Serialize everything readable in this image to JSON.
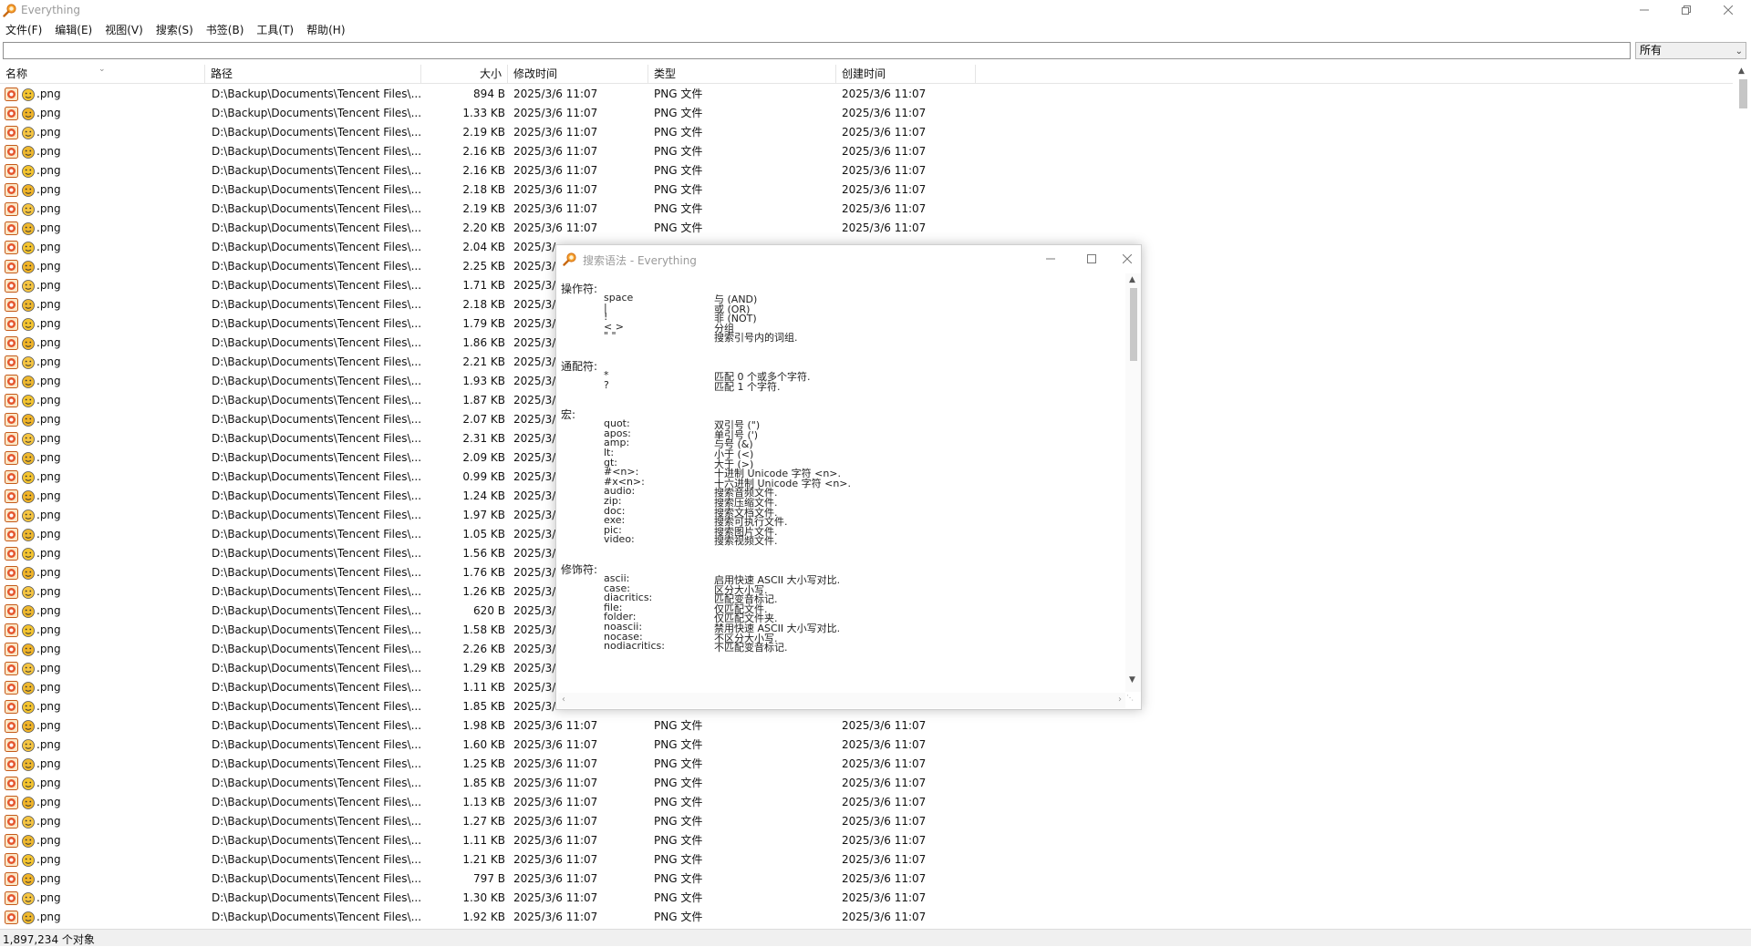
{
  "window": {
    "title": "Everything"
  },
  "menu": [
    "文件(F)",
    "编辑(E)",
    "视图(V)",
    "搜索(S)",
    "书签(B)",
    "工具(T)",
    "帮助(H)"
  ],
  "search": {
    "value": "",
    "placeholder": ""
  },
  "filter": {
    "selected": "所有"
  },
  "columns": {
    "name": "名称",
    "path": "路径",
    "size": "大小",
    "modified": "修改时间",
    "type": "类型",
    "created": "创建时间"
  },
  "rows": [
    {
      "name": ".png",
      "path": "D:\\Backup\\Documents\\Tencent Files\\...",
      "size": "894 B",
      "modified": "2025/3/6 11:07",
      "type": "PNG 文件",
      "created": "2025/3/6 11:07"
    },
    {
      "name": ".png",
      "path": "D:\\Backup\\Documents\\Tencent Files\\...",
      "size": "1.33 KB",
      "modified": "2025/3/6 11:07",
      "type": "PNG 文件",
      "created": "2025/3/6 11:07"
    },
    {
      "name": ".png",
      "path": "D:\\Backup\\Documents\\Tencent Files\\...",
      "size": "2.19 KB",
      "modified": "2025/3/6 11:07",
      "type": "PNG 文件",
      "created": "2025/3/6 11:07"
    },
    {
      "name": ".png",
      "path": "D:\\Backup\\Documents\\Tencent Files\\...",
      "size": "2.16 KB",
      "modified": "2025/3/6 11:07",
      "type": "PNG 文件",
      "created": "2025/3/6 11:07"
    },
    {
      "name": ".png",
      "path": "D:\\Backup\\Documents\\Tencent Files\\...",
      "size": "2.16 KB",
      "modified": "2025/3/6 11:07",
      "type": "PNG 文件",
      "created": "2025/3/6 11:07"
    },
    {
      "name": ".png",
      "path": "D:\\Backup\\Documents\\Tencent Files\\...",
      "size": "2.18 KB",
      "modified": "2025/3/6 11:07",
      "type": "PNG 文件",
      "created": "2025/3/6 11:07"
    },
    {
      "name": ".png",
      "path": "D:\\Backup\\Documents\\Tencent Files\\...",
      "size": "2.19 KB",
      "modified": "2025/3/6 11:07",
      "type": "PNG 文件",
      "created": "2025/3/6 11:07"
    },
    {
      "name": ".png",
      "path": "D:\\Backup\\Documents\\Tencent Files\\...",
      "size": "2.20 KB",
      "modified": "2025/3/6 11:07",
      "type": "PNG 文件",
      "created": "2025/3/6 11:07"
    },
    {
      "name": ".png",
      "path": "D:\\Backup\\Documents\\Tencent Files\\...",
      "size": "2.04 KB",
      "modified": "2025/3/",
      "type": "",
      "created": ""
    },
    {
      "name": ".png",
      "path": "D:\\Backup\\Documents\\Tencent Files\\...",
      "size": "2.25 KB",
      "modified": "2025/3/",
      "type": "",
      "created": ""
    },
    {
      "name": ".png",
      "path": "D:\\Backup\\Documents\\Tencent Files\\...",
      "size": "1.71 KB",
      "modified": "2025/3/",
      "type": "",
      "created": ""
    },
    {
      "name": ".png",
      "path": "D:\\Backup\\Documents\\Tencent Files\\...",
      "size": "2.18 KB",
      "modified": "2025/3/",
      "type": "",
      "created": ""
    },
    {
      "name": ".png",
      "path": "D:\\Backup\\Documents\\Tencent Files\\...",
      "size": "1.79 KB",
      "modified": "2025/3/",
      "type": "",
      "created": ""
    },
    {
      "name": ".png",
      "path": "D:\\Backup\\Documents\\Tencent Files\\...",
      "size": "1.86 KB",
      "modified": "2025/3/",
      "type": "",
      "created": ""
    },
    {
      "name": ".png",
      "path": "D:\\Backup\\Documents\\Tencent Files\\...",
      "size": "2.21 KB",
      "modified": "2025/3/",
      "type": "",
      "created": ""
    },
    {
      "name": ".png",
      "path": "D:\\Backup\\Documents\\Tencent Files\\...",
      "size": "1.93 KB",
      "modified": "2025/3/",
      "type": "",
      "created": ""
    },
    {
      "name": ".png",
      "path": "D:\\Backup\\Documents\\Tencent Files\\...",
      "size": "1.87 KB",
      "modified": "2025/3/",
      "type": "",
      "created": ""
    },
    {
      "name": ".png",
      "path": "D:\\Backup\\Documents\\Tencent Files\\...",
      "size": "2.07 KB",
      "modified": "2025/3/",
      "type": "",
      "created": ""
    },
    {
      "name": ".png",
      "path": "D:\\Backup\\Documents\\Tencent Files\\...",
      "size": "2.31 KB",
      "modified": "2025/3/",
      "type": "",
      "created": ""
    },
    {
      "name": ".png",
      "path": "D:\\Backup\\Documents\\Tencent Files\\...",
      "size": "2.09 KB",
      "modified": "2025/3/",
      "type": "",
      "created": ""
    },
    {
      "name": ".png",
      "path": "D:\\Backup\\Documents\\Tencent Files\\...",
      "size": "0.99 KB",
      "modified": "2025/3/",
      "type": "",
      "created": ""
    },
    {
      "name": ".png",
      "path": "D:\\Backup\\Documents\\Tencent Files\\...",
      "size": "1.24 KB",
      "modified": "2025/3/",
      "type": "",
      "created": ""
    },
    {
      "name": ".png",
      "path": "D:\\Backup\\Documents\\Tencent Files\\...",
      "size": "1.97 KB",
      "modified": "2025/3/",
      "type": "",
      "created": ""
    },
    {
      "name": ".png",
      "path": "D:\\Backup\\Documents\\Tencent Files\\...",
      "size": "1.05 KB",
      "modified": "2025/3/",
      "type": "",
      "created": ""
    },
    {
      "name": ".png",
      "path": "D:\\Backup\\Documents\\Tencent Files\\...",
      "size": "1.56 KB",
      "modified": "2025/3/",
      "type": "",
      "created": ""
    },
    {
      "name": ".png",
      "path": "D:\\Backup\\Documents\\Tencent Files\\...",
      "size": "1.76 KB",
      "modified": "2025/3/",
      "type": "",
      "created": ""
    },
    {
      "name": ".png",
      "path": "D:\\Backup\\Documents\\Tencent Files\\...",
      "size": "1.26 KB",
      "modified": "2025/3/",
      "type": "",
      "created": ""
    },
    {
      "name": ".png",
      "path": "D:\\Backup\\Documents\\Tencent Files\\...",
      "size": "620 B",
      "modified": "2025/3/",
      "type": "",
      "created": ""
    },
    {
      "name": ".png",
      "path": "D:\\Backup\\Documents\\Tencent Files\\...",
      "size": "1.58 KB",
      "modified": "2025/3/",
      "type": "",
      "created": ""
    },
    {
      "name": ".png",
      "path": "D:\\Backup\\Documents\\Tencent Files\\...",
      "size": "2.26 KB",
      "modified": "2025/3/",
      "type": "",
      "created": ""
    },
    {
      "name": ".png",
      "path": "D:\\Backup\\Documents\\Tencent Files\\...",
      "size": "1.29 KB",
      "modified": "2025/3/",
      "type": "",
      "created": ""
    },
    {
      "name": ".png",
      "path": "D:\\Backup\\Documents\\Tencent Files\\...",
      "size": "1.11 KB",
      "modified": "2025/3/",
      "type": "",
      "created": ""
    },
    {
      "name": ".png",
      "path": "D:\\Backup\\Documents\\Tencent Files\\...",
      "size": "1.85 KB",
      "modified": "2025/3/",
      "type": "",
      "created": ""
    },
    {
      "name": ".png",
      "path": "D:\\Backup\\Documents\\Tencent Files\\...",
      "size": "1.98 KB",
      "modified": "2025/3/6 11:07",
      "type": "PNG 文件",
      "created": "2025/3/6 11:07"
    },
    {
      "name": ".png",
      "path": "D:\\Backup\\Documents\\Tencent Files\\...",
      "size": "1.60 KB",
      "modified": "2025/3/6 11:07",
      "type": "PNG 文件",
      "created": "2025/3/6 11:07"
    },
    {
      "name": ".png",
      "path": "D:\\Backup\\Documents\\Tencent Files\\...",
      "size": "1.25 KB",
      "modified": "2025/3/6 11:07",
      "type": "PNG 文件",
      "created": "2025/3/6 11:07"
    },
    {
      "name": ".png",
      "path": "D:\\Backup\\Documents\\Tencent Files\\...",
      "size": "1.85 KB",
      "modified": "2025/3/6 11:07",
      "type": "PNG 文件",
      "created": "2025/3/6 11:07"
    },
    {
      "name": ".png",
      "path": "D:\\Backup\\Documents\\Tencent Files\\...",
      "size": "1.13 KB",
      "modified": "2025/3/6 11:07",
      "type": "PNG 文件",
      "created": "2025/3/6 11:07"
    },
    {
      "name": ".png",
      "path": "D:\\Backup\\Documents\\Tencent Files\\...",
      "size": "1.27 KB",
      "modified": "2025/3/6 11:07",
      "type": "PNG 文件",
      "created": "2025/3/6 11:07"
    },
    {
      "name": ".png",
      "path": "D:\\Backup\\Documents\\Tencent Files\\...",
      "size": "1.11 KB",
      "modified": "2025/3/6 11:07",
      "type": "PNG 文件",
      "created": "2025/3/6 11:07"
    },
    {
      "name": ".png",
      "path": "D:\\Backup\\Documents\\Tencent Files\\...",
      "size": "1.21 KB",
      "modified": "2025/3/6 11:07",
      "type": "PNG 文件",
      "created": "2025/3/6 11:07"
    },
    {
      "name": ".png",
      "path": "D:\\Backup\\Documents\\Tencent Files\\...",
      "size": "797 B",
      "modified": "2025/3/6 11:07",
      "type": "PNG 文件",
      "created": "2025/3/6 11:07"
    },
    {
      "name": ".png",
      "path": "D:\\Backup\\Documents\\Tencent Files\\...",
      "size": "1.30 KB",
      "modified": "2025/3/6 11:07",
      "type": "PNG 文件",
      "created": "2025/3/6 11:07"
    },
    {
      "name": ".png",
      "path": "D:\\Backup\\Documents\\Tencent Files\\...",
      "size": "1.92 KB",
      "modified": "2025/3/6 11:07",
      "type": "PNG 文件",
      "created": "2025/3/6 11:07"
    }
  ],
  "status": {
    "count": "1,897,234 个对象"
  },
  "dialog": {
    "title": "搜索语法 - Everything",
    "sections": [
      {
        "title": "操作符:",
        "items": [
          {
            "k": "space",
            "v": "与 (AND)"
          },
          {
            "k": "|",
            "v": "或 (OR)"
          },
          {
            "k": "!",
            "v": "非 (NOT)"
          },
          {
            "k": "< >",
            "v": "分组"
          },
          {
            "k": "\" \"",
            "v": "搜索引号内的词组."
          }
        ]
      },
      {
        "title": "通配符:",
        "items": [
          {
            "k": "*",
            "v": "匹配 0 个或多个字符."
          },
          {
            "k": "?",
            "v": "匹配 1 个字符."
          }
        ]
      },
      {
        "title": "宏:",
        "items": [
          {
            "k": "quot:",
            "v": "双引号 (\")"
          },
          {
            "k": "apos:",
            "v": "单引号 (')"
          },
          {
            "k": "amp:",
            "v": "与号 (&)"
          },
          {
            "k": "lt:",
            "v": "小于 (<)"
          },
          {
            "k": "gt:",
            "v": "大于 (>)"
          },
          {
            "k": "#<n>:",
            "v": "十进制 Unicode 字符 <n>."
          },
          {
            "k": "#x<n>:",
            "v": "十六进制 Unicode 字符 <n>."
          },
          {
            "k": "audio:",
            "v": "搜索音频文件."
          },
          {
            "k": "zip:",
            "v": "搜索压缩文件."
          },
          {
            "k": "doc:",
            "v": "搜索文档文件."
          },
          {
            "k": "exe:",
            "v": "搜索可执行文件."
          },
          {
            "k": "pic:",
            "v": "搜索图片文件."
          },
          {
            "k": "video:",
            "v": "搜索视频文件."
          }
        ]
      },
      {
        "title": "修饰符:",
        "items": [
          {
            "k": "ascii:",
            "v": "启用快速 ASCII 大小写对比."
          },
          {
            "k": "case:",
            "v": "区分大小写."
          },
          {
            "k": "diacritics:",
            "v": "匹配变音标记."
          },
          {
            "k": "file:",
            "v": "仅匹配文件."
          },
          {
            "k": "folder:",
            "v": "仅匹配文件夹."
          },
          {
            "k": "noascii:",
            "v": "禁用快速 ASCII 大小写对比."
          },
          {
            "k": "nocase:",
            "v": "不区分大小写."
          },
          {
            "k": "nodiacritics:",
            "v": "不匹配变音标记."
          }
        ]
      }
    ]
  }
}
